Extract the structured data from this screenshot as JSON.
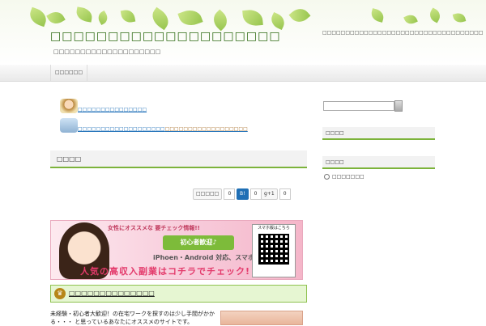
{
  "header": {
    "site_title": "□□□□□□□□□□□□□□□□□□□□",
    "site_description": "□□□□□□□□□□□□□□□□□□□□",
    "right_text": "□□□□□□□□□□□□□□□□□□□□□□□□□□□□□□□□□□□"
  },
  "nav": {
    "items": [
      {
        "label": "□□□□□□"
      }
    ]
  },
  "notices": [
    {
      "icon": "person-icon",
      "link": "□□□□□□□□□□□□□□□",
      "extra": ""
    },
    {
      "icon": "monitor-icon",
      "link": "□□□□□□□□□□□□□□□□□□□",
      "extra": "□□□□□□□□□□□□□□□□□□"
    }
  ],
  "main": {
    "section_title": "□□□□",
    "social": {
      "tweet_label": "□□□□□",
      "tweet_count": "0",
      "hatena_label": "B!",
      "hatena_count": "0",
      "gplus_label": "g+1",
      "gplus_count": "0"
    },
    "banner": {
      "line1": "女性にオススメな 要チェック情報!!",
      "green_label": "初心者歓迎♪",
      "line2": "iPhoen・Android 対応、スマホで出来る",
      "line3": "人気の高収入副業はコチラでチェック!",
      "qr_label": "スマホ版はこちら"
    },
    "green_box_title": "□□□□□□□□□□□□□□",
    "body_text": "未経験・初心者大歓迎！の在宅ワークを探すのは少し手間がかかる・・・ と思っているあなたにオススメのサイトです。"
  },
  "sidebar": {
    "search_placeholder": "",
    "widget1_title": "□□□□",
    "widget2_title": "□□□□",
    "widget2_item": "□□□□□□□"
  },
  "colors": {
    "accent_green": "#7cb33b",
    "link_blue": "#1d6fb8",
    "banner_pink": "#e33a6b"
  }
}
